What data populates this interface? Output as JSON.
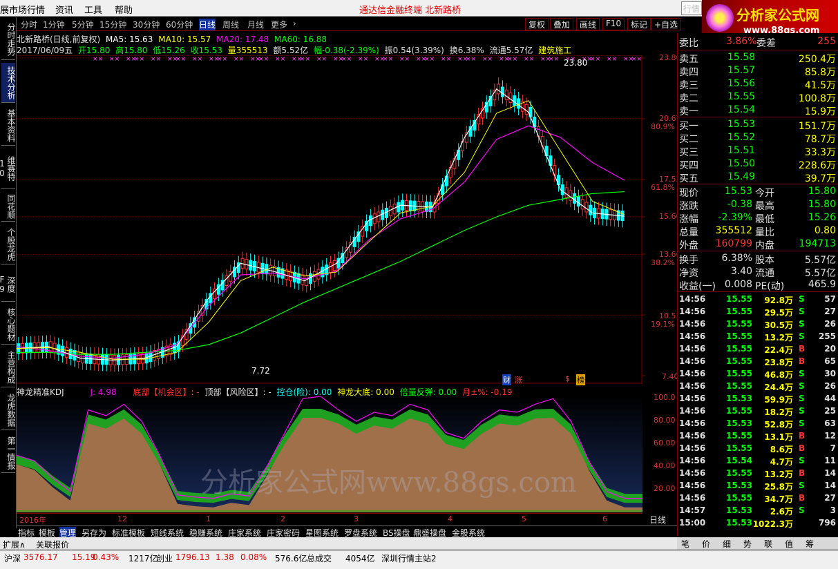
{
  "menu": {
    "items": [
      "展市场行情",
      "资讯",
      "工具",
      "帮助"
    ],
    "title": "通达信金融终端   北新路桥",
    "search": "行情"
  },
  "logo": {
    "text": "分析家公式网",
    "url": "www.88gs.com"
  },
  "left_tabs": [
    "分时走势",
    "技术分析",
    "基本资料",
    "维赛特10",
    "同花顺",
    "个股龙虎",
    "深度F9",
    "核心题材",
    "主营构成",
    "龙虎数据",
    "第一情报"
  ],
  "periods": [
    "分时",
    "1分钟",
    "5分钟",
    "15分钟",
    "30分钟",
    "60分钟",
    "日线",
    "周线",
    "月线",
    "更多",
    "›"
  ],
  "active_period": "日线",
  "right_buttons": [
    "复权",
    "叠加",
    "画线",
    "F10",
    "标记",
    "+自选"
  ],
  "info1": {
    "name": "北新路桥(日线,前复权)",
    "ma5": "MA5: 15.63",
    "ma10": "MA10: 15.57",
    "ma20": "MA20: 17.48",
    "ma60": "MA60: 16.88"
  },
  "info2": {
    "date": "2017/06/09五",
    "open": "开15.80",
    "high": "高15.80",
    "low": "低15.26",
    "close": "收15.53",
    "vol": "量355513",
    "amt": "额5.52亿",
    "chg": "幅-0.38(-2.39%)",
    "amp": "振0.54(3.39%)",
    "turn": "换6.38%",
    "float": "流通5.57亿",
    "ind": "建筑施工"
  },
  "price_axis": [
    "23.80",
    "20.67",
    "80.9%",
    "17.53",
    "61.8%",
    "15.60",
    "13.66",
    "38.2%",
    "10.53",
    "19.1%",
    "7.40"
  ],
  "price_marks": {
    "high": "23.80",
    "low": "7.72",
    "cai": "财",
    "zhang": "涨",
    "dollar": "$",
    "bang": "榜"
  },
  "kdj_info": {
    "name": "神龙精准KDJ",
    "j": "J: 4.98",
    "bottom": "底部【机会区】: -",
    "top": "顶部【风险区】: -",
    "kong": "控仓(险): 0.00",
    "shenlong": "神龙大底: 0.00",
    "beiliang": "倍量反弹: 0.00",
    "yue": "月±%: -0.19"
  },
  "kdj_axis": [
    "100.0",
    "80.00",
    "60.00",
    "40.00",
    "20.00"
  ],
  "watermark": "分析家公式网www.88gs.com",
  "x_axis": [
    "2016年",
    "12",
    "1",
    "2",
    "3",
    "4",
    "5",
    "6"
  ],
  "x_right": "日线",
  "bottom_tabs": [
    "指标",
    "模板",
    "管理",
    "另存为",
    "标准模板",
    "短线系统",
    "稳赚系统",
    "庄家系统",
    "庄家密码",
    "星图系统",
    "罗盘系统",
    "BS操盘",
    "鼎盛操盘",
    "金股系统"
  ],
  "quote": {
    "weibi": {
      "l": "委比",
      "v": "3.86%",
      "l2": "委差",
      "v2": "255"
    },
    "sell": [
      [
        "卖五",
        "15.58",
        "250.4万"
      ],
      [
        "卖四",
        "15.57",
        "85.8万"
      ],
      [
        "卖三",
        "15.56",
        "41.5万"
      ],
      [
        "卖二",
        "15.55",
        "100.8万"
      ],
      [
        "卖一",
        "15.54",
        "15.9万"
      ]
    ],
    "buy": [
      [
        "买一",
        "15.53",
        "151.7万"
      ],
      [
        "买二",
        "15.52",
        "78.7万"
      ],
      [
        "买三",
        "15.51",
        "33.3万"
      ],
      [
        "买四",
        "15.50",
        "228.6万"
      ],
      [
        "买五",
        "15.49",
        "39.7万"
      ]
    ],
    "stats": [
      [
        "现价",
        "15.53",
        "今开",
        "15.80"
      ],
      [
        "涨跌",
        "-0.38",
        "最高",
        "15.80"
      ],
      [
        "涨幅",
        "-2.39%",
        "最低",
        "15.26"
      ],
      [
        "总量",
        "355512",
        "量比",
        "0.80"
      ],
      [
        "外盘",
        "160799",
        "内盘",
        "194713"
      ]
    ],
    "stats2": [
      [
        "换手",
        "6.38%",
        "股本",
        "5.57亿"
      ],
      [
        "净资",
        "3.40",
        "流通",
        "5.57亿"
      ],
      [
        "收益(一)",
        "0.008",
        "PE(动)",
        "465.9"
      ]
    ]
  },
  "ticks": [
    [
      "14:56",
      "15.55",
      "92.8万",
      "S",
      "57"
    ],
    [
      "14:56",
      "15.55",
      "29.5万",
      "S",
      "27"
    ],
    [
      "14:56",
      "15.55",
      "30.5万",
      "S",
      "26"
    ],
    [
      "14:56",
      "15.55",
      "13.2万",
      "S",
      "255"
    ],
    [
      "14:56",
      "15.55",
      "22.4万",
      "B",
      "20"
    ],
    [
      "14:56",
      "15.55",
      "23.8万",
      "B",
      "65"
    ],
    [
      "14:56",
      "15.55",
      "46.8万",
      "S",
      "30"
    ],
    [
      "14:56",
      "15.55",
      "24.4万",
      "S",
      "26"
    ],
    [
      "14:56",
      "15.53",
      "59.9万",
      "S",
      "44"
    ],
    [
      "14:56",
      "15.55",
      "18.2万",
      "S",
      "25"
    ],
    [
      "14:56",
      "15.53",
      "52.8万",
      "S",
      "63"
    ],
    [
      "14:56",
      "15.55",
      "13.1万",
      "B",
      "12"
    ],
    [
      "14:56",
      "15.55",
      "8.6万",
      "B",
      "7"
    ],
    [
      "14:56",
      "15.54",
      "4.7万",
      "S",
      "11"
    ],
    [
      "14:56",
      "15.55",
      "13.2万",
      "B",
      "14"
    ],
    [
      "14:56",
      "15.53",
      "25.8万",
      "S",
      "14"
    ],
    [
      "14:56",
      "15.55",
      "34.7万",
      "B",
      "27"
    ],
    [
      "14:57",
      "15.53",
      "2.6万",
      "S",
      "3"
    ],
    [
      "15:00",
      "15.53",
      "1022.3万",
      "",
      "796"
    ]
  ],
  "right_tabs": [
    "笔",
    "价",
    "细",
    "势",
    "联",
    "值",
    "筹"
  ],
  "status": {
    "sh": "沪深",
    "sh_v": "3576.17",
    "sh_c": "15.19",
    "sh_p": "0.43%",
    "sh_a": "1217亿",
    "cy": "创业",
    "cy_v": "1796.13",
    "cy_c": "1.38",
    "cy_p": "0.08%",
    "cy_a": "576.6亿",
    "total": "总成交",
    "total_v": "4054亿",
    "server": "深圳行情主站2",
    "ext": "扩展∧",
    "quote": "关联报价"
  },
  "colors": {
    "up": "#ff3232",
    "down": "#00ffff",
    "ma5": "#ffffff",
    "ma10": "#ffff00",
    "ma20": "#ff00ff",
    "ma60": "#00ff00",
    "frame": "#800000"
  },
  "chart_data": {
    "type": "line",
    "title": "北新路桥(日线,前复权)",
    "ylim": [
      7.4,
      23.8
    ],
    "series": [
      {
        "name": "MA60",
        "values": [
          8.6,
          8.6,
          8.5,
          8.5,
          8.6,
          8.7,
          9.0,
          9.6,
          10.4,
          11.2,
          11.9,
          12.6,
          13.3,
          14.1,
          14.9,
          15.6,
          16.2,
          16.5,
          16.8,
          16.9
        ]
      },
      {
        "name": "MA20",
        "values": [
          8.9,
          8.7,
          8.4,
          8.3,
          8.5,
          9.0,
          11.0,
          12.6,
          12.7,
          12.4,
          12.8,
          14.4,
          15.5,
          16.0,
          17.4,
          19.6,
          20.3,
          19.7,
          18.4,
          17.48
        ]
      },
      {
        "name": "MA5",
        "values": [
          8.8,
          8.9,
          8.3,
          8.2,
          8.3,
          8.9,
          11.4,
          13.2,
          12.8,
          12.3,
          13.2,
          15.4,
          16.2,
          16.1,
          19.7,
          22.2,
          21.0,
          17.0,
          15.8,
          15.63
        ]
      }
    ]
  }
}
